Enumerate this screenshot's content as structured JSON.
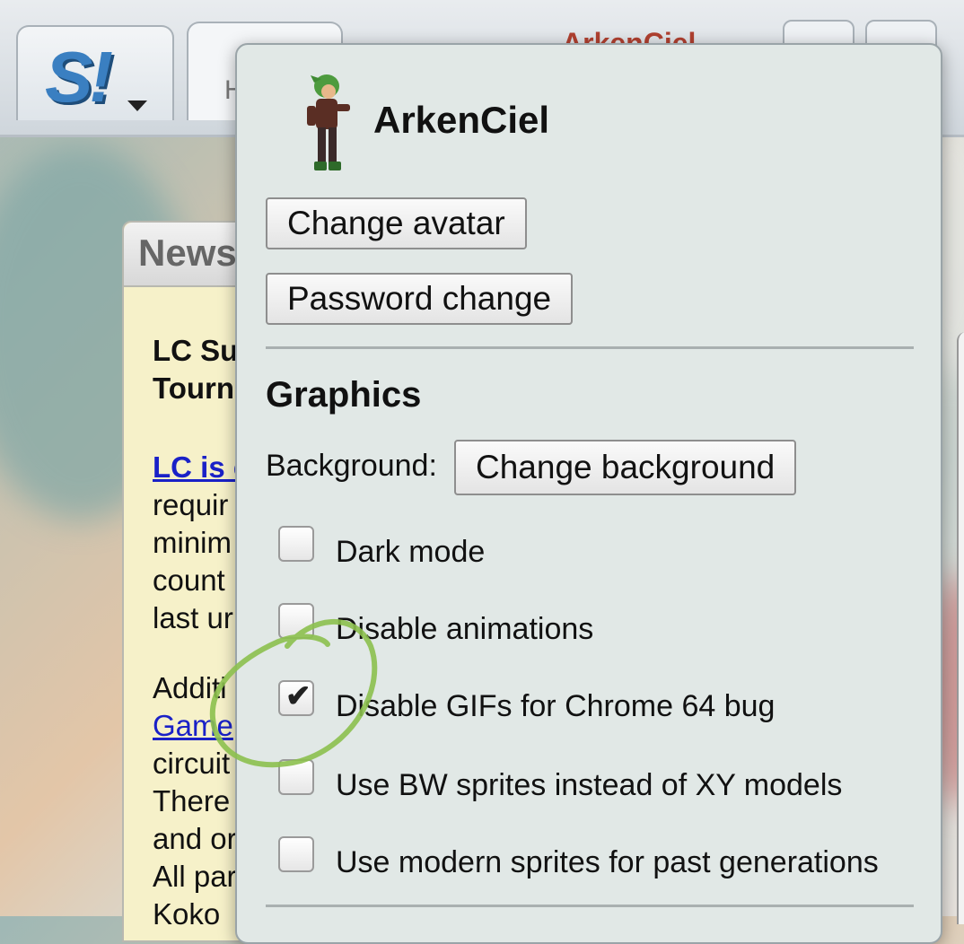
{
  "header": {
    "logo_text": "S!",
    "home_tab_label": "H",
    "username_peek": "ArkenCiel"
  },
  "news": {
    "title": "News",
    "lines": [
      {
        "text": "LC Su",
        "style": "bold"
      },
      {
        "text": "Tourn",
        "style": "bold"
      },
      {
        "text": "LC is c",
        "style": "link-bold"
      },
      {
        "text": "requir",
        "style": "normal"
      },
      {
        "text": "minim",
        "style": "normal"
      },
      {
        "text": "count",
        "style": "normal"
      },
      {
        "text": "last ur",
        "style": "normal"
      },
      {
        "text": "Additi",
        "style": "normal"
      },
      {
        "text": "Game",
        "style": "link"
      },
      {
        "text": "circuit",
        "style": "normal"
      },
      {
        "text": "There",
        "style": "normal"
      },
      {
        "text": "and or",
        "style": "normal"
      },
      {
        "text": "All par",
        "style": "normal"
      },
      {
        "text": "Koko",
        "style": "normal"
      }
    ]
  },
  "popup": {
    "username": "ArkenCiel",
    "change_avatar_label": "Change avatar",
    "password_change_label": "Password change",
    "graphics_title": "Graphics",
    "background_label": "Background:",
    "change_background_label": "Change background",
    "options": [
      {
        "label": "Dark mode",
        "checked": false
      },
      {
        "label": "Disable animations",
        "checked": false
      },
      {
        "label": "Disable GIFs for Chrome 64 bug",
        "checked": true
      },
      {
        "label": "Use BW sprites instead of XY models",
        "checked": false
      },
      {
        "label": "Use modern sprites for past generations",
        "checked": false
      }
    ]
  },
  "colors": {
    "annotation": "#8cc04e",
    "popup_bg": "#e1e8e6",
    "link": "#1a21c7"
  }
}
